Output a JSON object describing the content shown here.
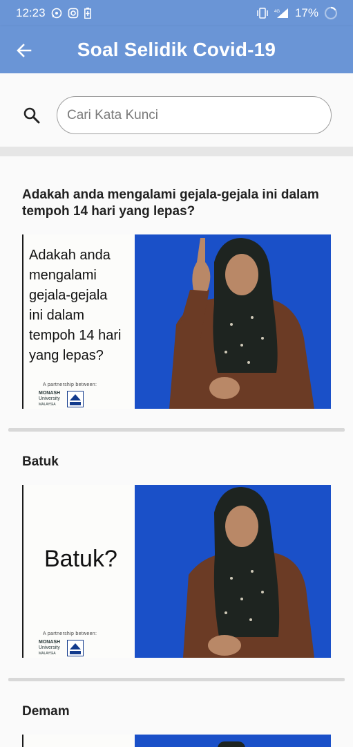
{
  "status_bar": {
    "time": "12:23",
    "battery": "17%",
    "network": "4G"
  },
  "app_bar": {
    "title": "Soal Selidik Covid-19",
    "back_icon": "arrow-back-icon"
  },
  "search": {
    "placeholder": "Cari Kata Kunci",
    "value": "",
    "icon": "search-icon"
  },
  "items": [
    {
      "title": "Adakah anda mengalami gejala-gejala ini dalam tempoh 14 hari yang lepas?",
      "image_text": [
        "Adakah anda",
        "mengalami",
        "gejala-gejala",
        "ini dalam",
        "tempoh 14 hari",
        "yang lepas?"
      ],
      "partner_text": "A partnership between:",
      "logo_text": [
        "MONASH",
        "University",
        "MALAYSIA"
      ]
    },
    {
      "title": "Batuk",
      "image_text": [
        "Batuk?"
      ],
      "partner_text": "A partnership between:",
      "logo_text": [
        "MONASH",
        "University",
        "MALAYSIA"
      ]
    },
    {
      "title": "Demam"
    }
  ],
  "colors": {
    "primary": "#6a95d6",
    "video_background": "#1a50c8"
  }
}
